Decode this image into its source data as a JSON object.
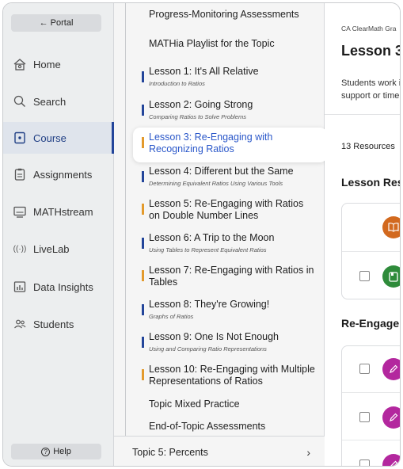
{
  "sidebar": {
    "portal": "← Portal",
    "items": [
      {
        "label": "Home",
        "icon": "home-icon"
      },
      {
        "label": "Search",
        "icon": "search-icon"
      },
      {
        "label": "Course",
        "icon": "course-icon"
      },
      {
        "label": "Assignments",
        "icon": "assignments-icon"
      },
      {
        "label": "MATHstream",
        "icon": "mathstream-icon"
      },
      {
        "label": "LiveLab",
        "icon": "livelab-icon"
      },
      {
        "label": "Data Insights",
        "icon": "data-insights-icon"
      },
      {
        "label": "Students",
        "icon": "students-icon"
      }
    ],
    "active_item": "Course",
    "help": "Help"
  },
  "topic_panel": {
    "top_rows": [
      "Progress-Monitoring Assessments",
      "MATHia Playlist for the Topic"
    ],
    "lessons": [
      {
        "title": "Lesson 1: It's All Relative",
        "subtitle": "Introduction to Ratios",
        "kind": "lesson"
      },
      {
        "title": "Lesson 2: Going Strong",
        "subtitle": "Comparing Ratios to Solve Problems",
        "kind": "lesson"
      },
      {
        "title": "Lesson 3: Re-Engaging with Recognizing Ratios",
        "subtitle": "",
        "kind": "re-engaging",
        "selected": true
      },
      {
        "title": "Lesson 4: Different but the Same",
        "subtitle": "Determining Equivalent Ratios Using Various Tools",
        "kind": "lesson"
      },
      {
        "title": "Lesson 5: Re-Engaging with Ratios on Double Number Lines",
        "subtitle": "",
        "kind": "re-engaging"
      },
      {
        "title": "Lesson 6: A Trip to the Moon",
        "subtitle": "Using Tables to Represent Equivalent Ratios",
        "kind": "lesson"
      },
      {
        "title": "Lesson 7: Re-Engaging with Ratios in Tables",
        "subtitle": "",
        "kind": "re-engaging"
      },
      {
        "title": "Lesson 8: They're Growing!",
        "subtitle": "Graphs of Ratios",
        "kind": "lesson"
      },
      {
        "title": "Lesson 9: One Is Not Enough",
        "subtitle": "Using and Comparing Ratio Representations",
        "kind": "lesson"
      },
      {
        "title": "Lesson 10: Re-Engaging with Multiple Representations of Ratios",
        "subtitle": "",
        "kind": "re-engaging"
      }
    ],
    "bottom_rows": [
      "Topic Mixed Practice",
      "End-of-Topic Assessments"
    ],
    "next_topic": "Topic 5: Percents",
    "next_icon": "chevron-right-icon"
  },
  "main": {
    "breadcrumb": "CA ClearMath Gra",
    "title": "Lesson 3:",
    "description_lines": [
      "Students work i",
      "support or time"
    ],
    "resources_count": "13 Resources",
    "section_lesson_resources": "Lesson Res",
    "section_re_engagement": "Re-Engagem"
  },
  "colors": {
    "lesson_marker": "#23459a",
    "re_engaging_marker": "#e39a2c",
    "selected_text": "#2a57c9",
    "nav_active_bar": "#23459a",
    "book_circle": "#d2691e",
    "doc_circle": "#2e8b3a",
    "pencil_circle": "#b3279e"
  }
}
